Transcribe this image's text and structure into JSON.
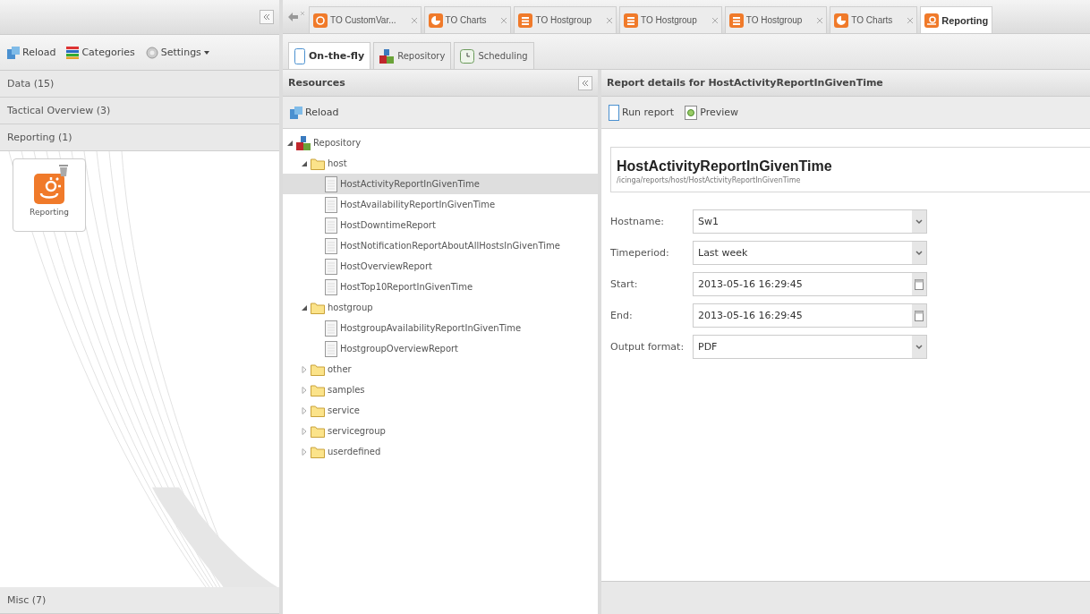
{
  "left_panel": {
    "toolbar": [
      {
        "label": "Reload",
        "kind": "reload"
      },
      {
        "label": "Categories",
        "kind": "categories"
      },
      {
        "label": "Settings",
        "kind": "settings"
      }
    ],
    "categories": [
      {
        "label": "Data (15)"
      },
      {
        "label": "Tactical Overview (3)"
      },
      {
        "label": "Reporting (1)",
        "items": [
          {
            "label": "Reporting"
          }
        ]
      }
    ],
    "footer_category": {
      "label": "Misc (7)"
    }
  },
  "tabs": [
    {
      "label": "TO CustomVar...",
      "kind": "custom",
      "selected": false
    },
    {
      "label": "TO Charts",
      "kind": "charts",
      "selected": false
    },
    {
      "label": "TO Hostgroup",
      "kind": "list",
      "selected": false
    },
    {
      "label": "TO Hostgroup",
      "kind": "list",
      "selected": false
    },
    {
      "label": "TO Hostgroup",
      "kind": "list",
      "selected": false
    },
    {
      "label": "TO Charts",
      "kind": "charts",
      "selected": false
    },
    {
      "label": "Reporting",
      "kind": "reporting",
      "selected": true
    }
  ],
  "sub_tabs": [
    {
      "label": "On-the-fly",
      "kind": "onthefly",
      "selected": true
    },
    {
      "label": "Repository",
      "kind": "repository",
      "selected": false
    },
    {
      "label": "Scheduling",
      "kind": "scheduling",
      "selected": false
    }
  ],
  "resources": {
    "title": "Resources",
    "toolbar": [
      "Reload"
    ],
    "tree": [
      {
        "label": "Repository",
        "kind": "root",
        "expanded": true,
        "children": [
          {
            "label": "host",
            "kind": "folder",
            "expanded": true,
            "children": [
              {
                "label": "HostActivityReportInGivenTime",
                "kind": "file",
                "selected": true
              },
              {
                "label": "HostAvailabilityReportInGivenTime",
                "kind": "file",
                "selected": false
              },
              {
                "label": "HostDowntimeReport",
                "kind": "file",
                "selected": false
              },
              {
                "label": "HostNotificationReportAboutAllHostsInGivenTime",
                "kind": "file",
                "selected": false
              },
              {
                "label": "HostOverviewReport",
                "kind": "file",
                "selected": false
              },
              {
                "label": "HostTop10ReportInGivenTime",
                "kind": "file",
                "selected": false
              }
            ]
          },
          {
            "label": "hostgroup",
            "kind": "folder",
            "expanded": true,
            "children": [
              {
                "label": "HostgroupAvailabilityReportInGivenTime",
                "kind": "file",
                "selected": false
              },
              {
                "label": "HostgroupOverviewReport",
                "kind": "file",
                "selected": false
              }
            ]
          },
          {
            "label": "other",
            "kind": "folder",
            "expanded": false
          },
          {
            "label": "samples",
            "kind": "folder",
            "expanded": false
          },
          {
            "label": "service",
            "kind": "folder",
            "expanded": false
          },
          {
            "label": "servicegroup",
            "kind": "folder",
            "expanded": false
          },
          {
            "label": "userdefined",
            "kind": "folder",
            "expanded": false
          }
        ]
      }
    ]
  },
  "details": {
    "title": "Report details for HostActivityReportInGivenTime",
    "toolbar": [
      {
        "label": "Run report",
        "kind": "run"
      },
      {
        "label": "Preview",
        "kind": "preview"
      }
    ],
    "report_name": "HostActivityReportInGivenTime",
    "report_path": "/icinga/reports/host/HostActivityReportInGivenTime",
    "fields": [
      {
        "label": "Hostname:",
        "value": "Sw1",
        "kind": "select"
      },
      {
        "label": "Timeperiod:",
        "value": "Last week",
        "kind": "select"
      },
      {
        "label": "Start:",
        "value": "2013-05-16 16:29:45",
        "kind": "date"
      },
      {
        "label": "End:",
        "value": "2013-05-16 16:29:45",
        "kind": "date"
      },
      {
        "label": "Output format:",
        "value": "PDF",
        "kind": "select"
      }
    ]
  }
}
